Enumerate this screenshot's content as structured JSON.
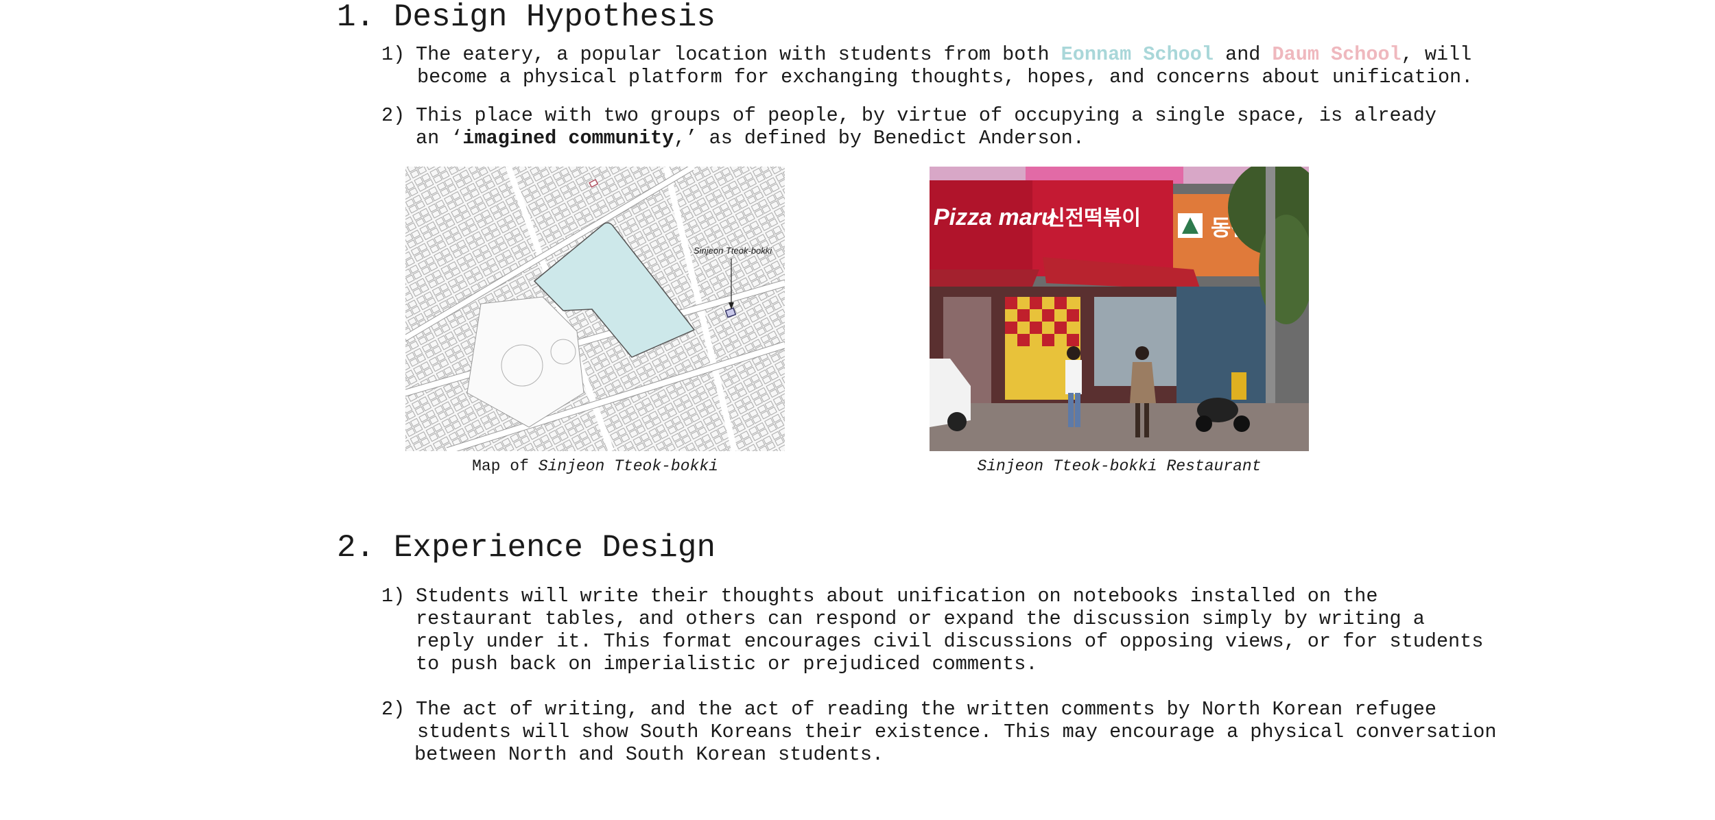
{
  "section1": {
    "heading": "1. Design Hypothesis",
    "items": [
      {
        "num": "1)",
        "text_a": "The eatery, a popular location with students from both ",
        "school_a": "Eonnam School",
        "text_b": " and ",
        "school_b": "Daum School",
        "text_c": ", will",
        "line2": "become a physical platform for exchanging thoughts, hopes, and concerns about unification."
      },
      {
        "num": "2)",
        "line1": "This place with two groups of people, by virtue of occupying a single space, is already",
        "line2_a": "an ‘",
        "line2_bold": "imagined community",
        "line2_b": ",’ as defined by Benedict Anderson."
      }
    ],
    "figures": {
      "map_label": "Sinjeon Tteok-bokki",
      "map_caption_prefix": "Map of ",
      "map_caption_italic": "Sinjeon Tteok-bokki",
      "photo_caption": "Sinjeon Tteok-bokki Restaurant",
      "photo_signs": {
        "pizza": "Pizza maru",
        "sinjeon": "신전떡볶이",
        "right": "동산"
      }
    }
  },
  "section2": {
    "heading": "2. Experience Design",
    "items": [
      {
        "num": "1)",
        "lines": [
          "Students will write their thoughts about unification on notebooks installed on the",
          "restaurant tables, and others can respond or expand the discussion simply by writing a",
          "reply under it. This format encourages civil discussions of opposing views, or for students",
          "to push back on imperialistic or prejudiced comments."
        ]
      },
      {
        "num": "2)",
        "lines": [
          "The act of writing, and the act of reading the written comments by North Korean refugee",
          "students will show South Koreans their existence. This may encourage a physical conversation",
          "between North and South Korean students."
        ]
      }
    ]
  },
  "colors": {
    "eonnam": "#a9d7d9",
    "daum": "#efb8be",
    "map_highlight": "#cde8ea"
  }
}
